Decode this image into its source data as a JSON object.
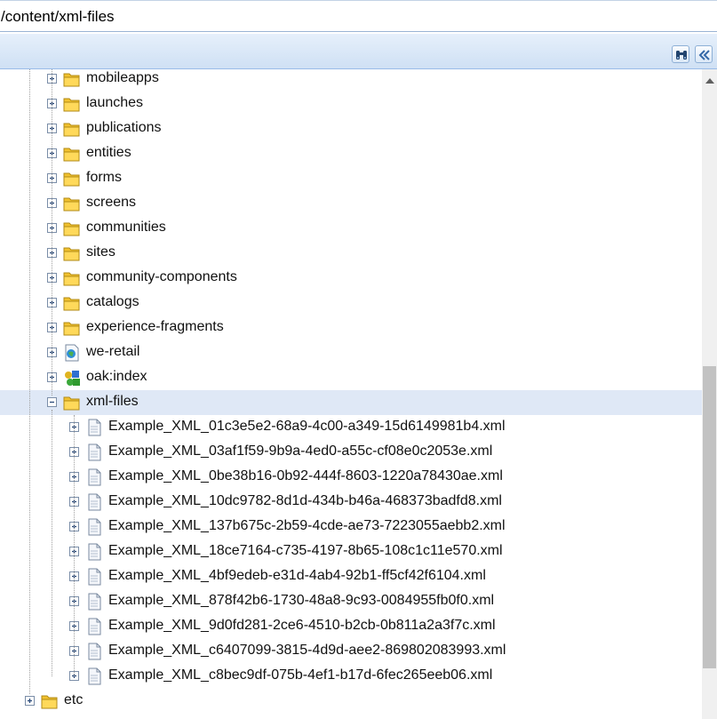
{
  "path": {
    "value": "/content/xml-files"
  },
  "toolbar": {
    "search_icon": "binoculars-icon",
    "collapse_icon": "double-chevron-left-icon"
  },
  "colors": {
    "folder": "#f2c12e",
    "selected_row": "#dfe8f6",
    "toolbar_border": "#99bbe8"
  },
  "tree": {
    "folders": [
      {
        "label": "mobileapps",
        "icon": "folder-icon"
      },
      {
        "label": "launches",
        "icon": "folder-icon"
      },
      {
        "label": "publications",
        "icon": "folder-icon"
      },
      {
        "label": "entities",
        "icon": "folder-icon"
      },
      {
        "label": "forms",
        "icon": "folder-icon"
      },
      {
        "label": "screens",
        "icon": "folder-icon"
      },
      {
        "label": "communities",
        "icon": "folder-icon"
      },
      {
        "label": "sites",
        "icon": "folder-icon"
      },
      {
        "label": "community-components",
        "icon": "folder-icon"
      },
      {
        "label": "catalogs",
        "icon": "folder-icon"
      },
      {
        "label": "experience-fragments",
        "icon": "folder-icon"
      },
      {
        "label": "we-retail",
        "icon": "site-page-icon"
      },
      {
        "label": "oak:index",
        "icon": "index-icon"
      }
    ],
    "selected": {
      "label": "xml-files",
      "icon": "folder-icon"
    },
    "files": [
      "Example_XML_01c3e5e2-68a9-4c00-a349-15d6149981b4.xml",
      "Example_XML_03af1f59-9b9a-4ed0-a55c-cf08e0c2053e.xml",
      "Example_XML_0be38b16-0b92-444f-8603-1220a78430ae.xml",
      "Example_XML_10dc9782-8d1d-434b-b46a-468373badfd8.xml",
      "Example_XML_137b675c-2b59-4cde-ae73-7223055aebb2.xml",
      "Example_XML_18ce7164-c735-4197-8b65-108c1c11e570.xml",
      "Example_XML_4bf9edeb-e31d-4ab4-92b1-ff5cf42f6104.xml",
      "Example_XML_878f42b6-1730-48a8-9c93-0084955fb0f0.xml",
      "Example_XML_9d0fd281-2ce6-4510-b2cb-0b811a2a3f7c.xml",
      "Example_XML_c6407099-3815-4d9d-aee2-869802083993.xml",
      "Example_XML_c8bec9df-075b-4ef1-b17d-6fec265eeb06.xml"
    ],
    "root_sibling": {
      "label": "etc",
      "icon": "folder-icon"
    }
  }
}
